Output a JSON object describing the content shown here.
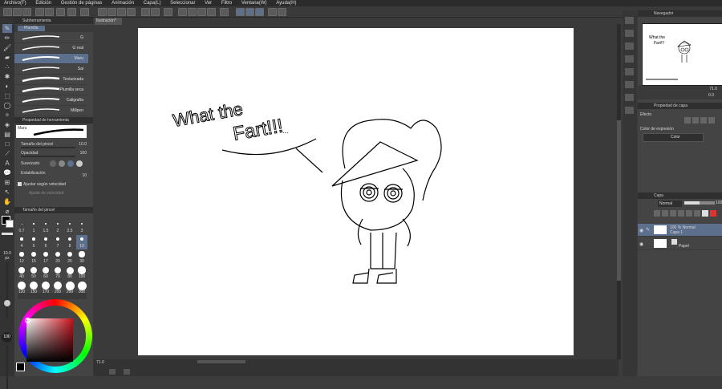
{
  "menu": [
    "Archivo(F)",
    "Edición",
    "Gestión de páginas",
    "Animación",
    "Capa(L)",
    "Seleccionar",
    "Ver",
    "Filtro",
    "Ventana(W)",
    "Ayuda(H)"
  ],
  "doc_tab": "Ilustración*",
  "subtool": {
    "header": "Subherramienta",
    "group": "Plumilla",
    "brushes": [
      "G",
      "G real",
      "Maru",
      "Sai",
      "Texturizada",
      "Plumilla seca",
      "Caligrafía",
      "Millpen"
    ],
    "selected": "Maru"
  },
  "tool_property": {
    "header": "Propiedad de herramienta",
    "preset": "Maru",
    "brush_size_label": "Tamaño del pincel",
    "brush_size_value": "10.0",
    "opacity_label": "Opacidad",
    "opacity_value": "100",
    "smoothing_label": "Suavizado",
    "stabilization_label": "Estabilización",
    "stabilization_value": "10",
    "speed_checkbox_label": "Ajustar según velocidad",
    "speed_hint": "Ajuste de velocidad"
  },
  "brush_size_panel": {
    "header": "Tamaño del pincel",
    "sizes": [
      "0.7",
      "1",
      "1.5",
      "2",
      "2.5",
      "3",
      "4",
      "5",
      "6",
      "7",
      "8",
      "10",
      "12",
      "15",
      "17",
      "20",
      "25",
      "30",
      "40",
      "50",
      "60",
      "70",
      "80",
      "100",
      "120",
      "150",
      "170",
      "200",
      "250",
      "300"
    ],
    "selected": "10"
  },
  "left_side_size": "10.0",
  "left_side_unit": "px",
  "left_side_opacity": "100",
  "right": {
    "navigator_title": "Navegador",
    "zoom": "71.0",
    "angle": "0.0",
    "layer_property_title": "Propiedad de capa",
    "effect_label": "Efecto",
    "expression_color_label": "Color de expresión",
    "expression_color_value": "Color",
    "layers_title": "Capa",
    "blend_mode": "Normal",
    "opacity": "100",
    "layers": [
      {
        "line1": "100 % Normal",
        "line2": "Capa 1",
        "selected": true
      },
      {
        "line1": "",
        "line2": "Papel",
        "selected": false
      }
    ]
  },
  "canvas": {
    "speech_line1": "What the",
    "speech_line2": "Fart!!!",
    "speech_dots": "...",
    "zoom_status": "71.0"
  }
}
